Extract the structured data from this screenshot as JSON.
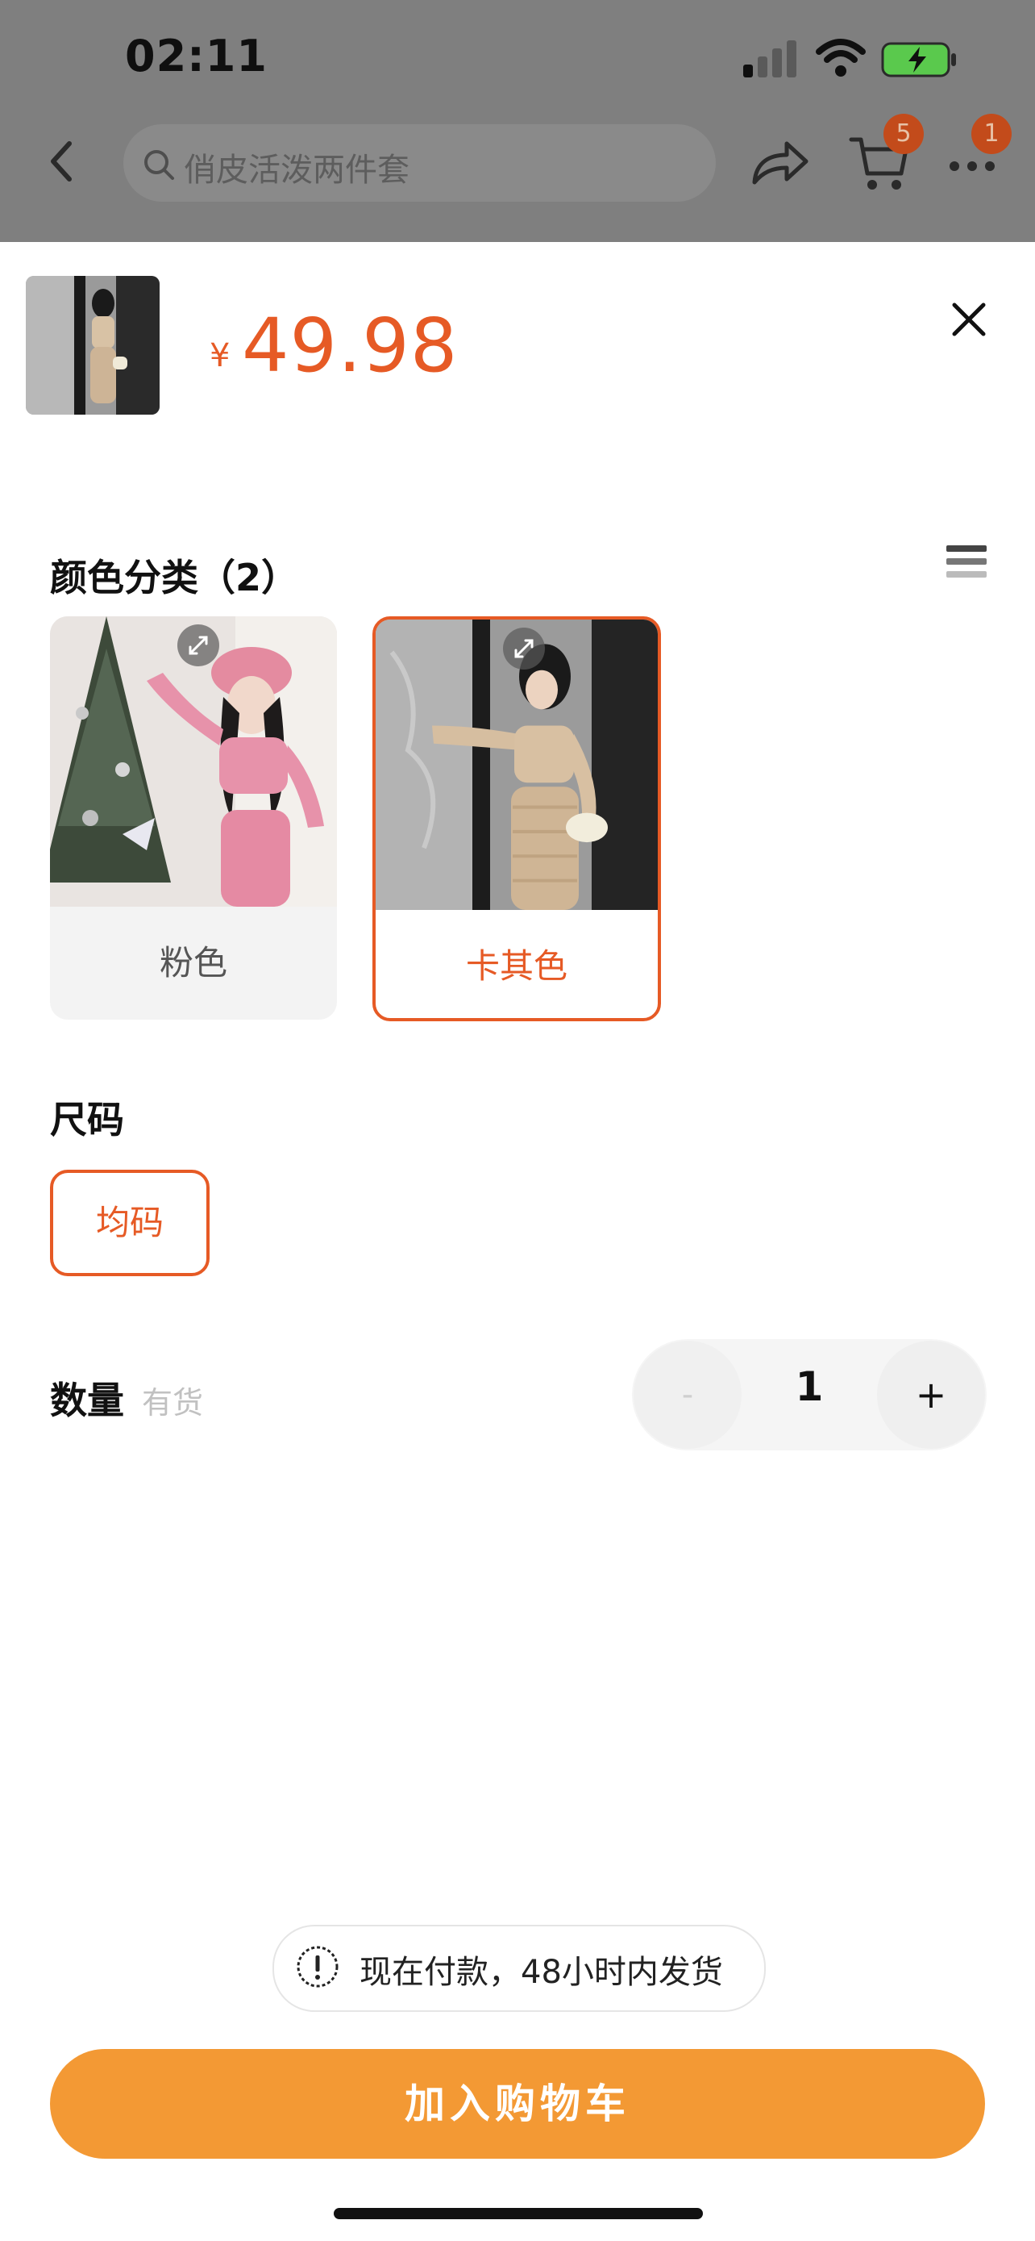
{
  "status_bar": {
    "time": "02:11"
  },
  "header": {
    "search_placeholder": "俏皮活泼两件套",
    "cart_badge": "5",
    "more_badge": "1"
  },
  "product": {
    "currency": "¥",
    "price": "49.98"
  },
  "color_section": {
    "title": "颜色分类（2）",
    "options": [
      {
        "label": "粉色",
        "selected": false
      },
      {
        "label": "卡其色",
        "selected": true
      }
    ]
  },
  "size_section": {
    "title": "尺码",
    "options": [
      {
        "label": "均码",
        "selected": true
      }
    ]
  },
  "quantity_section": {
    "title": "数量",
    "status": "有货",
    "minus": "-",
    "value": "1",
    "plus": "+"
  },
  "notice": {
    "text": "现在付款，48小时内发货"
  },
  "footer": {
    "add_to_cart": "加入购物车"
  },
  "colors": {
    "accent": "#e65a25",
    "button": "#f39934",
    "badge": "#c34b1b"
  },
  "icons": [
    "back-icon",
    "search-icon",
    "share-icon",
    "cart-icon",
    "more-icon",
    "close-icon",
    "list-icon",
    "expand-icon",
    "exclamation-icon",
    "signal-icon",
    "wifi-icon",
    "battery-icon"
  ]
}
